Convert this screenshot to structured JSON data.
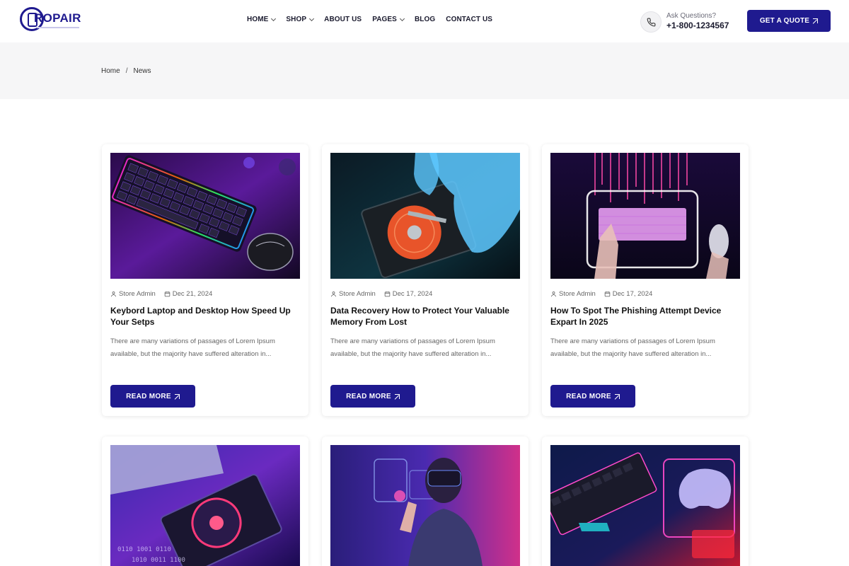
{
  "brand": {
    "name": "ROPAIR",
    "logo_icon": "phone-repair-icon",
    "accent": "#1f1a8f"
  },
  "nav": [
    {
      "label": "HOME",
      "dropdown": true
    },
    {
      "label": "SHOP",
      "dropdown": true
    },
    {
      "label": "ABOUT US",
      "dropdown": false
    },
    {
      "label": "PAGES",
      "dropdown": true
    },
    {
      "label": "BLOG",
      "dropdown": false
    },
    {
      "label": "CONTACT US",
      "dropdown": false
    }
  ],
  "contact": {
    "ask_label": "Ask Questions?",
    "phone": "+1-800-1234567",
    "icon": "phone-icon"
  },
  "quote_button": "GET A QUOTE",
  "breadcrumb": {
    "home": "Home",
    "separator": "/",
    "current": "News"
  },
  "posts": [
    {
      "author": "Store Admin",
      "date": "Dec 21, 2024",
      "title": "Keybord Laptop and Desktop How Speed Up Your Setps",
      "excerpt": "There are many variations of passages of Lorem Ipsum available, but the majority have suffered alteration in...",
      "button": "READ MORE",
      "image": "rgb-keyboard-and-mouse"
    },
    {
      "author": "Store Admin",
      "date": "Dec 17, 2024",
      "title": "Data Recovery How to Protect Your Valuable Memory From Lost",
      "excerpt": "There are many variations of passages of Lorem Ipsum available, but the majority have suffered alteration in...",
      "button": "READ MORE",
      "image": "gloved-hands-hard-drive"
    },
    {
      "author": "Store Admin",
      "date": "Dec 17, 2024",
      "title": "How To Spot The Phishing Attempt Device Expart In 2025",
      "excerpt": "There are many variations of passages of Lorem Ipsum available, but the majority have suffered alteration in...",
      "button": "READ MORE",
      "image": "hands-on-glowing-keyboard"
    },
    {
      "image": "open-hard-drive-binary"
    },
    {
      "image": "person-vr-headset"
    },
    {
      "image": "gaming-keyboard-controller"
    }
  ]
}
